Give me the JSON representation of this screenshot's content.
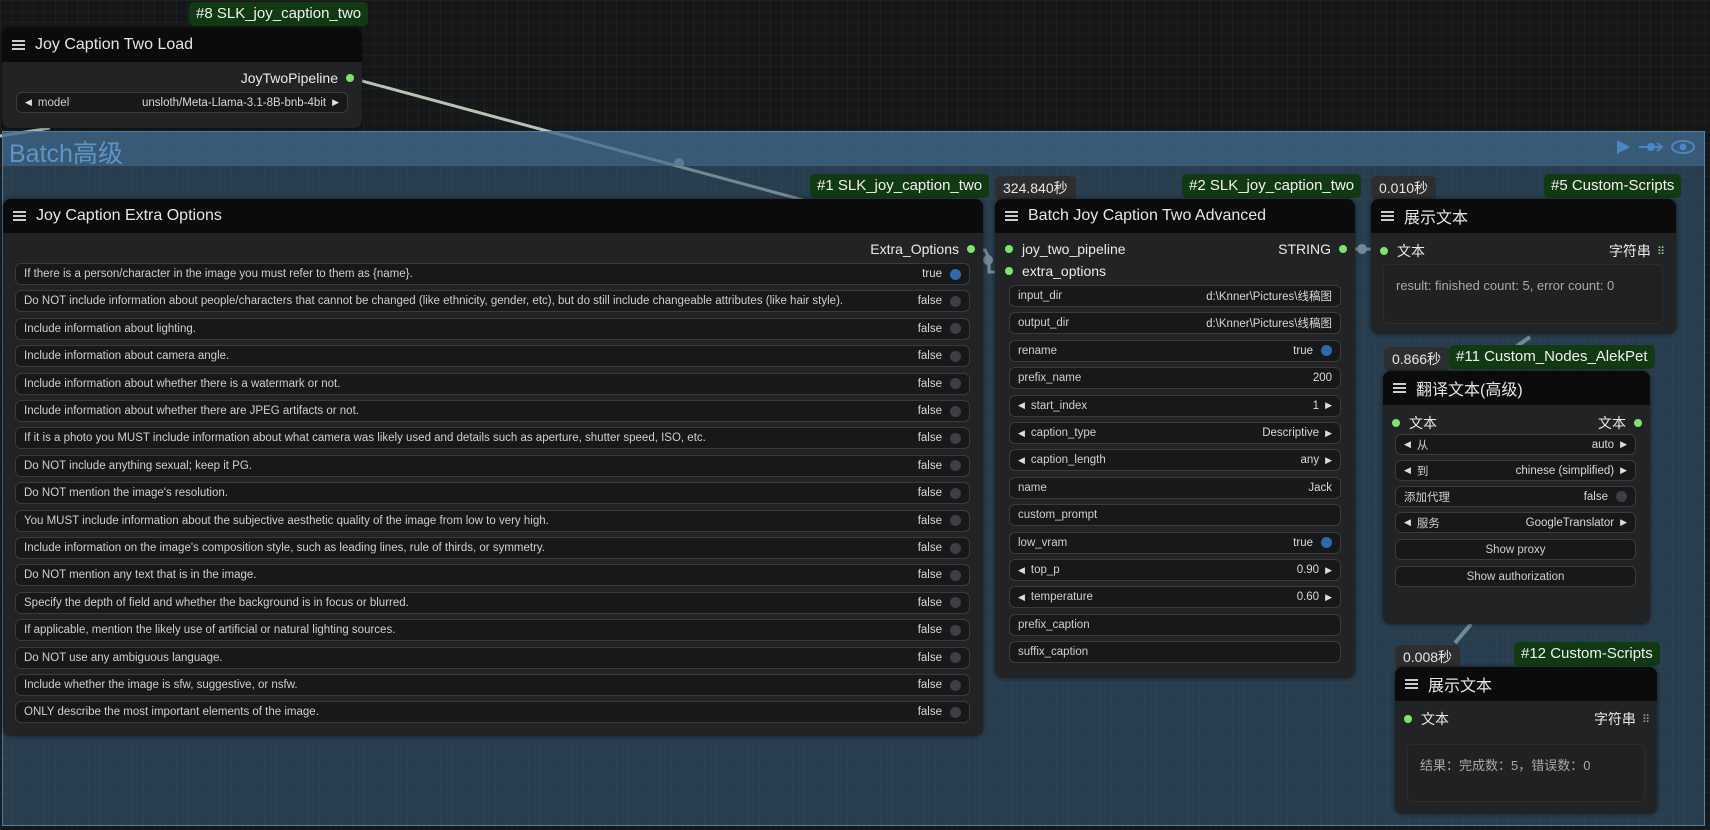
{
  "group": {
    "title": "Batch高级"
  },
  "node8": {
    "badge": "#8 SLK_joy_caption_two",
    "title": "Joy Caption Two Load",
    "output": "JoyTwoPipeline",
    "model_label": "model",
    "model_value": "unsloth/Meta-Llama-3.1-8B-bnb-4bit"
  },
  "node1": {
    "badge": "#1 SLK_joy_caption_two",
    "title": "Joy Caption Extra Options",
    "output": "Extra_Options",
    "options": [
      {
        "label": "If there is a person/character in the image you must refer to them as {name}.",
        "value": "true",
        "on": true
      },
      {
        "label": "Do NOT include information about people/characters that cannot be changed (like ethnicity, gender, etc), but do still include changeable attributes (like hair style).",
        "value": "false",
        "on": false
      },
      {
        "label": "Include information about lighting.",
        "value": "false",
        "on": false
      },
      {
        "label": "Include information about camera angle.",
        "value": "false",
        "on": false
      },
      {
        "label": "Include information about whether there is a watermark or not.",
        "value": "false",
        "on": false
      },
      {
        "label": "Include information about whether there are JPEG artifacts or not.",
        "value": "false",
        "on": false
      },
      {
        "label": "If it is a photo you MUST include information about what camera was likely used and details such as aperture, shutter speed, ISO, etc.",
        "value": "false",
        "on": false
      },
      {
        "label": "Do NOT include anything sexual; keep it PG.",
        "value": "false",
        "on": false
      },
      {
        "label": "Do NOT mention the image's resolution.",
        "value": "false",
        "on": false
      },
      {
        "label": "You MUST include information about the subjective aesthetic quality of the image from low to very high.",
        "value": "false",
        "on": false
      },
      {
        "label": "Include information on the image's composition style, such as leading lines, rule of thirds, or symmetry.",
        "value": "false",
        "on": false
      },
      {
        "label": "Do NOT mention any text that is in the image.",
        "value": "false",
        "on": false
      },
      {
        "label": "Specify the depth of field and whether the background is in focus or blurred.",
        "value": "false",
        "on": false
      },
      {
        "label": "If applicable, mention the likely use of artificial or natural lighting sources.",
        "value": "false",
        "on": false
      },
      {
        "label": "Do NOT use any ambiguous language.",
        "value": "false",
        "on": false
      },
      {
        "label": "Include whether the image is sfw, suggestive, or nsfw.",
        "value": "false",
        "on": false
      },
      {
        "label": "ONLY describe the most important elements of the image.",
        "value": "false",
        "on": false
      }
    ]
  },
  "node2": {
    "time": "324.840秒",
    "badge": "#2 SLK_joy_caption_two",
    "title": "Batch Joy Caption Two Advanced",
    "input1": "joy_two_pipeline",
    "input2": "extra_options",
    "output": "STRING",
    "widgets": [
      {
        "label": "input_dir",
        "value": "d:\\Knner\\Pictures\\线稿图",
        "kind": "text"
      },
      {
        "label": "output_dir",
        "value": "d:\\Knner\\Pictures\\线稿图",
        "kind": "text"
      },
      {
        "label": "rename",
        "value": "true",
        "kind": "toggle",
        "on": true
      },
      {
        "label": "prefix_name",
        "value": "200",
        "kind": "text"
      },
      {
        "label": "start_index",
        "value": "1",
        "kind": "number"
      },
      {
        "label": "caption_type",
        "value": "Descriptive",
        "kind": "combo"
      },
      {
        "label": "caption_length",
        "value": "any",
        "kind": "combo"
      },
      {
        "label": "name",
        "value": "Jack",
        "kind": "text"
      },
      {
        "label": "custom_prompt",
        "value": "",
        "kind": "text"
      },
      {
        "label": "low_vram",
        "value": "true",
        "kind": "toggle",
        "on": true
      },
      {
        "label": "top_p",
        "value": "0.90",
        "kind": "number"
      },
      {
        "label": "temperature",
        "value": "0.60",
        "kind": "number"
      },
      {
        "label": "prefix_caption",
        "value": "",
        "kind": "text"
      },
      {
        "label": "suffix_caption",
        "value": "",
        "kind": "text"
      }
    ]
  },
  "node5": {
    "time": "0.010秒",
    "badge": "#5 Custom-Scripts",
    "title": "展示文本",
    "input": "文本",
    "output": "字符串",
    "text": "result: finished count: 5, error count: 0"
  },
  "node11": {
    "time": "0.866秒",
    "badge": "#11 Custom_Nodes_AlekPet",
    "title": "翻译文本(高级)",
    "input": "文本",
    "output": "文本",
    "from_label": "从",
    "from_value": "auto",
    "to_label": "到",
    "to_value": "chinese (simplified)",
    "proxy_label": "添加代理",
    "proxy_value": "false",
    "service_label": "服务",
    "service_value": "GoogleTranslator",
    "show_proxy": "Show proxy",
    "show_auth": "Show authorization"
  },
  "node12": {
    "time": "0.008秒",
    "badge": "#12 Custom-Scripts",
    "title": "展示文本",
    "input": "文本",
    "output": "字符串",
    "text": "结果：完成数：5，错误数：0"
  },
  "colors": {
    "link": "#b5c4b5",
    "slot": "#7ee46e",
    "badge_bg": "#113a12",
    "group": "#385c7c",
    "toggle_on": "#2f69a8"
  }
}
